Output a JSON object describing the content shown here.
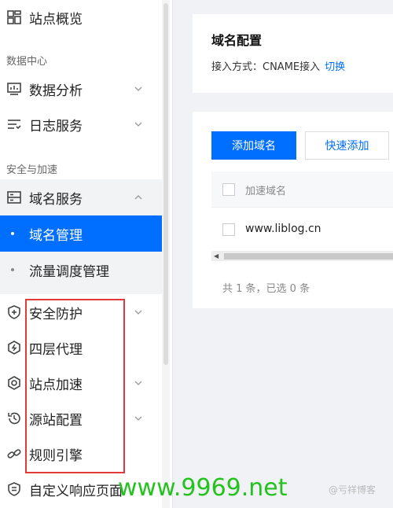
{
  "sidebar": {
    "items": [
      {
        "label": "站点概览",
        "icon": "grid-icon"
      },
      {
        "label": "数据分析",
        "icon": "monitor-chart-icon"
      },
      {
        "label": "日志服务",
        "icon": "list-icon"
      },
      {
        "label": "域名服务",
        "icon": "server-icon"
      },
      {
        "label": "安全防护",
        "icon": "shield-plus-icon"
      },
      {
        "label": "四层代理",
        "icon": "hexagon-icon"
      },
      {
        "label": "站点加速",
        "icon": "eye-icon"
      },
      {
        "label": "源站配置",
        "icon": "history-icon"
      },
      {
        "label": "规则引擎",
        "icon": "link-icon"
      },
      {
        "label": "自定义响应页面",
        "icon": "shield-list-icon"
      }
    ],
    "groups": [
      "数据中心",
      "安全与加速"
    ],
    "subitems": [
      {
        "label": "域名管理",
        "active": true
      },
      {
        "label": "流量调度管理",
        "active": false
      }
    ]
  },
  "card1": {
    "title": "域名配置",
    "access_label": "接入方式：CNAME接入",
    "switch_link": "切换"
  },
  "card2": {
    "add_button": "添加域名",
    "quick_add_button": "快速添加",
    "table": {
      "header": "加速域名",
      "rows": [
        {
          "domain": "www.liblog.cn"
        }
      ]
    },
    "footer": "共 1 条，已选 0 条"
  },
  "watermark": {
    "url": "www.9969.net",
    "brand": "@亏祥博客"
  },
  "colors": {
    "accent": "#006eff",
    "highlight": "#e33a3a",
    "watermark": "#24c21e"
  }
}
